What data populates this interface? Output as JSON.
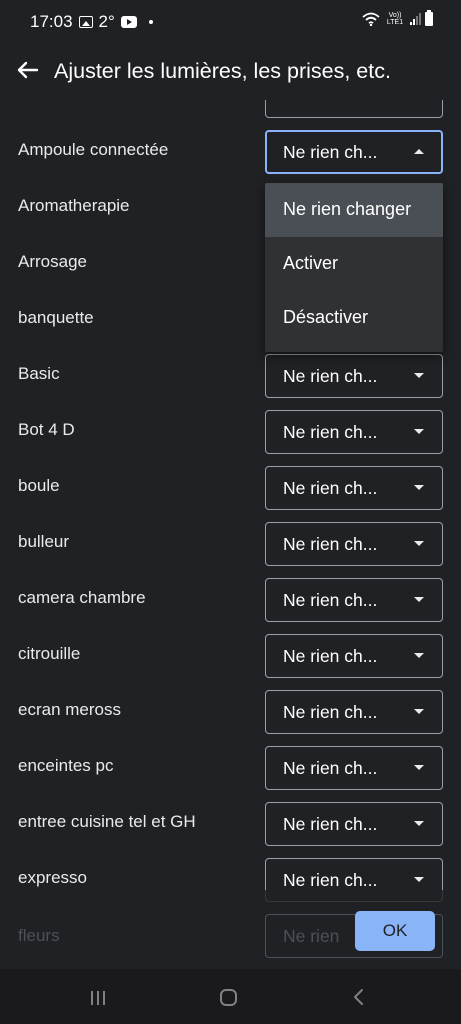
{
  "status_bar": {
    "time": "17:03",
    "temperature": "2°",
    "network_label": "Vo)) LTE1",
    "icons": [
      "gallery-icon",
      "youtube-icon",
      "wifi-icon",
      "signal-icon",
      "battery-icon"
    ]
  },
  "app_bar": {
    "title": "Ajuster les lumières, les prises, etc.",
    "back_icon": "arrow-left-icon"
  },
  "devices": [
    {
      "name": "Ampoule connectée",
      "value": "Ne rien ch...",
      "focused": true
    },
    {
      "name": "Aromatherapie",
      "value": ""
    },
    {
      "name": "Arrosage",
      "value": ""
    },
    {
      "name": "banquette",
      "value": ""
    },
    {
      "name": "Basic",
      "value": "Ne rien ch..."
    },
    {
      "name": "Bot 4 D",
      "value": "Ne rien ch..."
    },
    {
      "name": "boule",
      "value": "Ne rien ch..."
    },
    {
      "name": "bulleur",
      "value": "Ne rien ch..."
    },
    {
      "name": "camera chambre",
      "value": "Ne rien ch..."
    },
    {
      "name": "citrouille",
      "value": "Ne rien ch..."
    },
    {
      "name": "ecran meross",
      "value": "Ne rien ch..."
    },
    {
      "name": "enceintes pc",
      "value": "Ne rien ch..."
    },
    {
      "name": "entree cuisine tel et GH",
      "value": "Ne rien ch..."
    },
    {
      "name": "expresso",
      "value": "Ne rien ch..."
    }
  ],
  "faded_row": {
    "name": "fleurs",
    "value": "Ne rien"
  },
  "dropdown": {
    "options": [
      "Ne rien changer",
      "Activer",
      "Désactiver"
    ],
    "selected_index": 0
  },
  "ok_label": "OK",
  "colors": {
    "background": "#202124",
    "accent": "#8ab4f8",
    "menu_bg": "#303134",
    "menu_selected": "#4a4f56"
  }
}
